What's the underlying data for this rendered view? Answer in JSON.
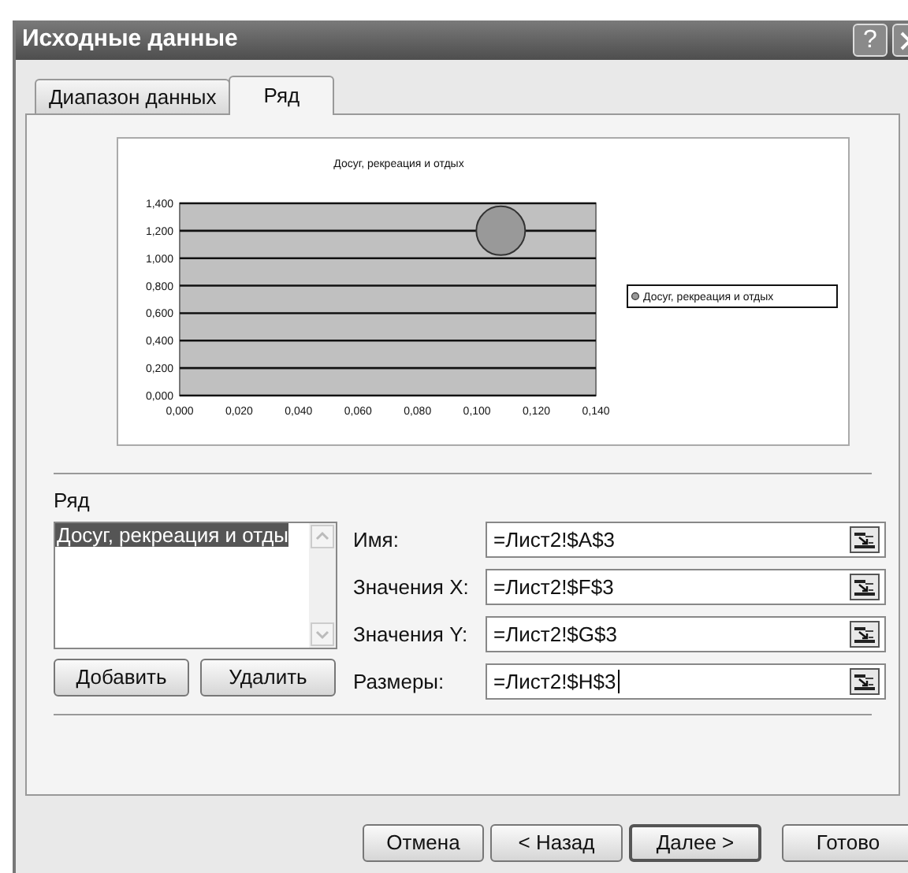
{
  "window": {
    "title": "Исходные данные",
    "help": "?"
  },
  "tabs": [
    {
      "label": "Диапазон данных",
      "selected": false
    },
    {
      "label": "Ряд",
      "selected": true
    }
  ],
  "chart": {
    "chart_data": {
      "type": "scatter",
      "title": "Досуг, рекреация и отдых",
      "x": [
        0.108
      ],
      "grid": true,
      "series": [
        {
          "name": "Досуг, рекреация и отдых",
          "color": "#999999",
          "values": [
            1.2
          ]
        }
      ],
      "xlim": [
        0,
        0.14
      ],
      "ylim": [
        0,
        1.4
      ],
      "xticks": [
        {
          "value": 0,
          "label": "0,000"
        },
        {
          "value": 0.02,
          "label": "0,020"
        },
        {
          "value": 0.04,
          "label": "0,040"
        },
        {
          "value": 0.06,
          "label": "0,060"
        },
        {
          "value": 0.08,
          "label": "0,080"
        },
        {
          "value": 0.1,
          "label": "0,100"
        },
        {
          "value": 0.12,
          "label": "0,120"
        },
        {
          "value": 0.14,
          "label": "0,140"
        }
      ],
      "yticks": [
        {
          "value": 0,
          "label": "0,000"
        },
        {
          "value": 0.2,
          "label": "0,200"
        },
        {
          "value": 0.4,
          "label": "0,400"
        },
        {
          "value": 0.6,
          "label": "0,600"
        },
        {
          "value": 0.8,
          "label": "0,800"
        },
        {
          "value": 1,
          "label": "1,000"
        },
        {
          "value": 1.2,
          "label": "1,200"
        },
        {
          "value": 1.4,
          "label": "1,400"
        }
      ]
    }
  },
  "series_list": {
    "label": "Ряд",
    "items": [
      {
        "label": "Досуг, рекреация и отды",
        "selected": true
      }
    ]
  },
  "series_buttons": [
    {
      "label": "Добавить"
    },
    {
      "label": "Удалить"
    }
  ],
  "fields": [
    {
      "label": "Имя:",
      "value": "=Лист2!$A$3",
      "focused": false
    },
    {
      "label": "Значения X:",
      "value": "=Лист2!$F$3",
      "focused": false
    },
    {
      "label": "Значения Y:",
      "value": "=Лист2!$G$3",
      "focused": false
    },
    {
      "label": "Размеры:",
      "value": "=Лист2!$H$3",
      "focused": true
    }
  ],
  "buttons": [
    {
      "label": "Отмена",
      "default": false
    },
    {
      "label": "< Назад",
      "default": false
    },
    {
      "label": "Далее >",
      "default": true
    },
    {
      "label": "Готово",
      "default": false
    }
  ]
}
